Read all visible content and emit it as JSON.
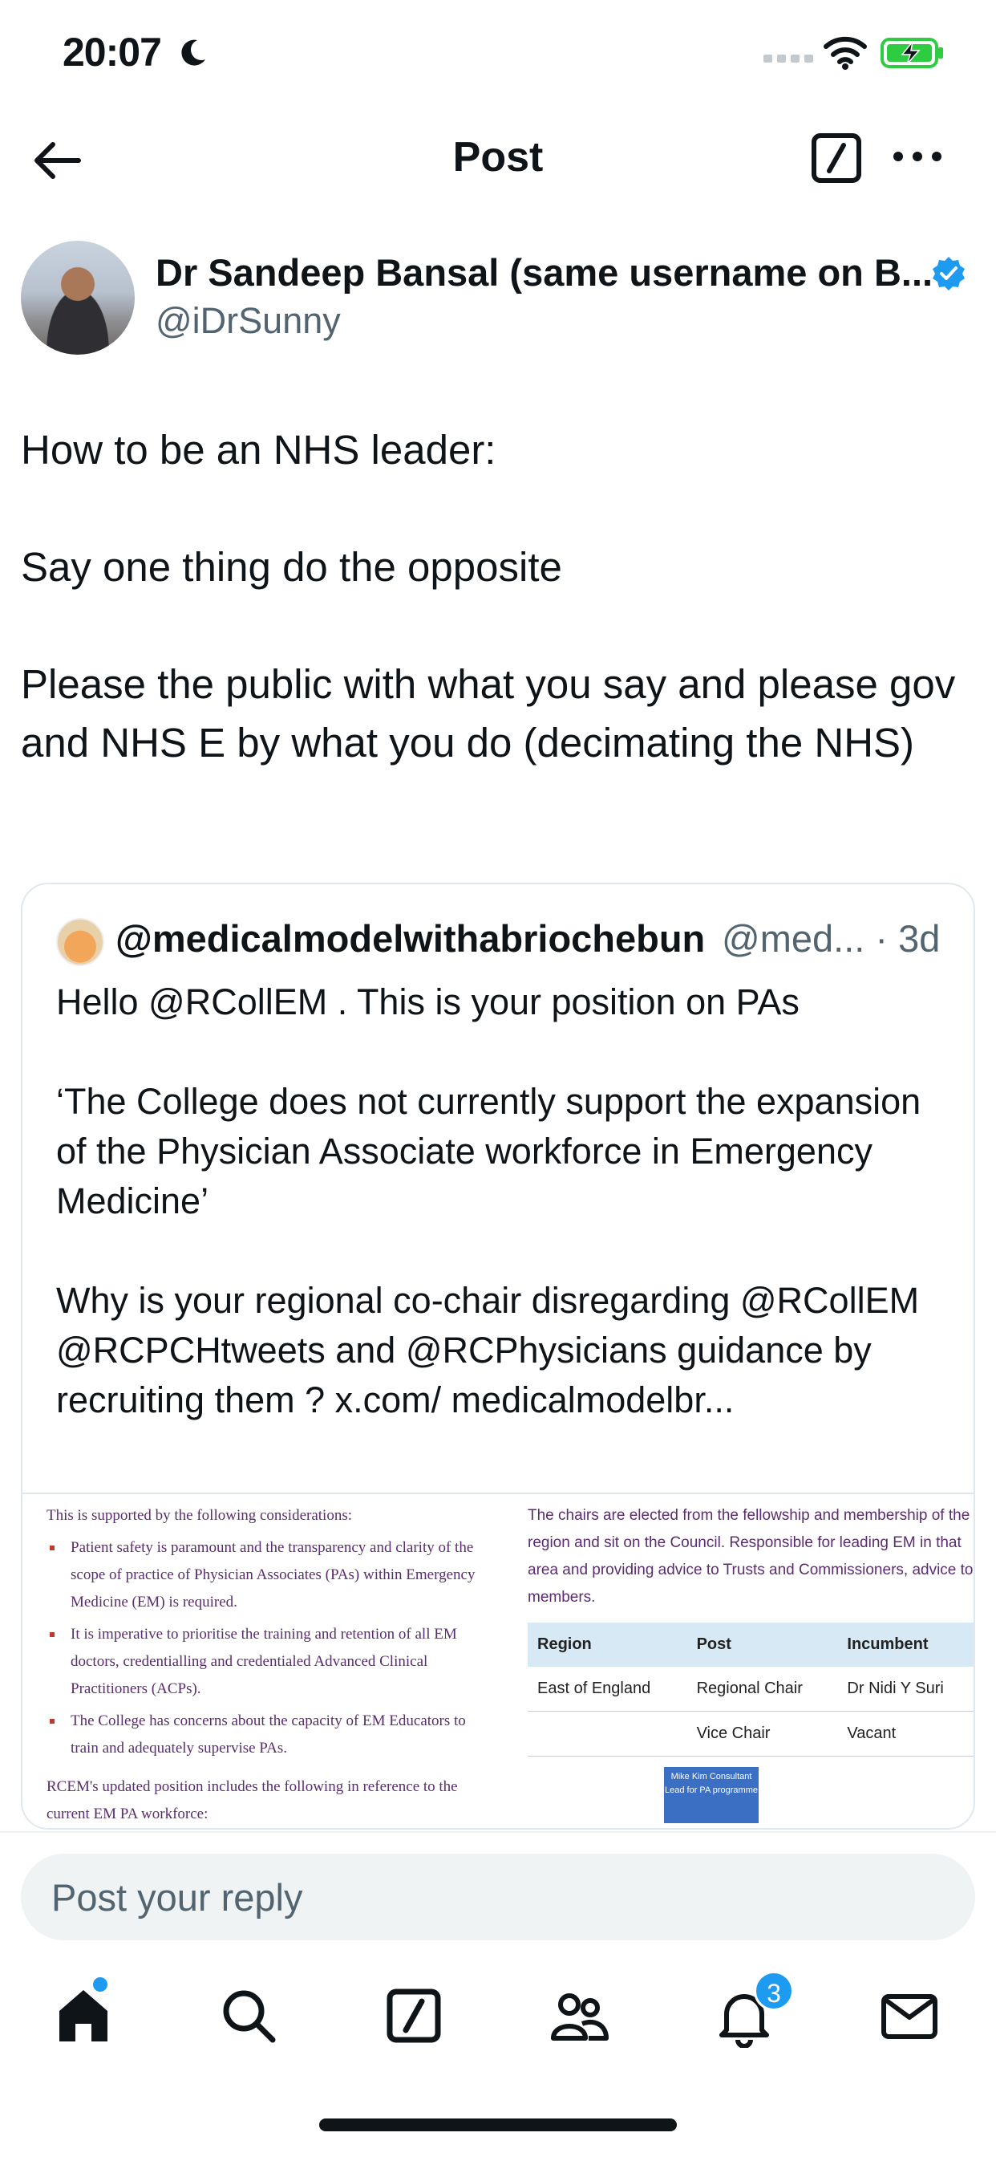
{
  "status": {
    "time": "20:07"
  },
  "topbar": {
    "title": "Post"
  },
  "author": {
    "name": "Dr Sandeep Bansal (same username on B...",
    "handle": "@iDrSunny"
  },
  "post": {
    "lines": [
      "How to be an NHS leader:",
      "",
      "Say one thing do the opposite",
      "",
      "Please the public with what you say and please gov and NHS E by what you do (decimating the NHS)"
    ]
  },
  "quote": {
    "name": "@medicalmodelwithabriochebun",
    "meta": "@med... · 3d",
    "lines": [
      "Hello @RCollEM . This is your position on PAs",
      "",
      "‘The College does not currently support the expansion of the Physician Associate workforce in Emergency Medicine’",
      "",
      "Why is your regional co-chair disregarding @RCollEM @RCPCHtweets and @RCPhysicians guidance by recruiting them ? x.com/ medicalmodelbr..."
    ],
    "image": {
      "left_heading": "This is supported by the following considerations:",
      "left_bullets": [
        "Patient safety is paramount and the transparency and clarity of the scope of practice of Physician Associates (PAs) within Emergency Medicine (EM) is required.",
        "It is imperative to prioritise the training and retention of all EM doctors, credentialling and credentialed Advanced Clinical Practitioners (ACPs).",
        "The College has concerns about the capacity of EM Educators to train and adequately supervise PAs."
      ],
      "left_tail": "RCEM's updated position includes the following in reference to the current EM PA workforce:",
      "right_intro": "The chairs are elected from the fellowship and membership of the region and sit on the Council. Responsible for leading EM in that area and providing advice to Trusts and Commissioners, advice to members.",
      "table_headers": [
        "Region",
        "Post",
        "Incumbent"
      ],
      "table_rows": [
        [
          "East of England",
          "Regional Chair",
          "Dr Nidi Y Suri"
        ],
        [
          "",
          "Vice Chair",
          "Vacant"
        ]
      ],
      "org_box": "Mike Kim Consultant Lead for PA programme"
    }
  },
  "reply": {
    "placeholder": "Post your reply"
  },
  "tabbar": {
    "notifications_count": "3"
  },
  "colors": {
    "accent": "#1d9bf0",
    "text": "#0f1419",
    "muted": "#536471"
  }
}
